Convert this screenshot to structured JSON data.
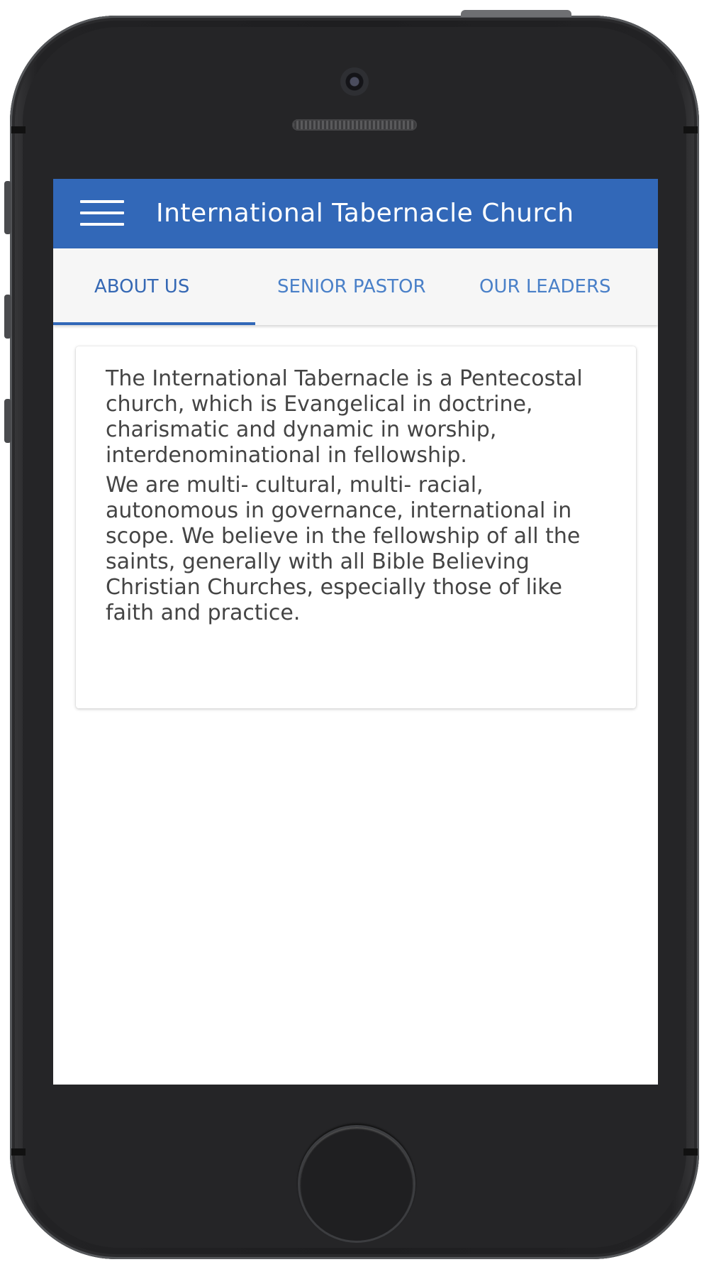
{
  "app": {
    "title": "International Tabernacle Church"
  },
  "tabs": [
    {
      "label": "ABOUT US",
      "selected": true
    },
    {
      "label": "SENIOR PASTOR",
      "selected": false
    },
    {
      "label": "OUR LEADERS",
      "selected": false
    }
  ],
  "about": {
    "paragraphs": [
      "The International Tabernacle is a Pentecostal church, which is Evangelical in doctrine, charismatic and dynamic in worship, interdenominational in fellowship.",
      "We are multi- cultural, multi- racial, autonomous in governance, international in scope. We believe in the fellowship of all the saints, generally with all Bible Believing Christian Churches, especially those of like faith and practice."
    ]
  },
  "icons": {
    "menu": "hamburger-menu-icon"
  },
  "colors": {
    "app_bar": "#3268b8",
    "tab_text": "#4a80c8",
    "tab_indicator": "#3268b8",
    "body_text": "#444444"
  }
}
